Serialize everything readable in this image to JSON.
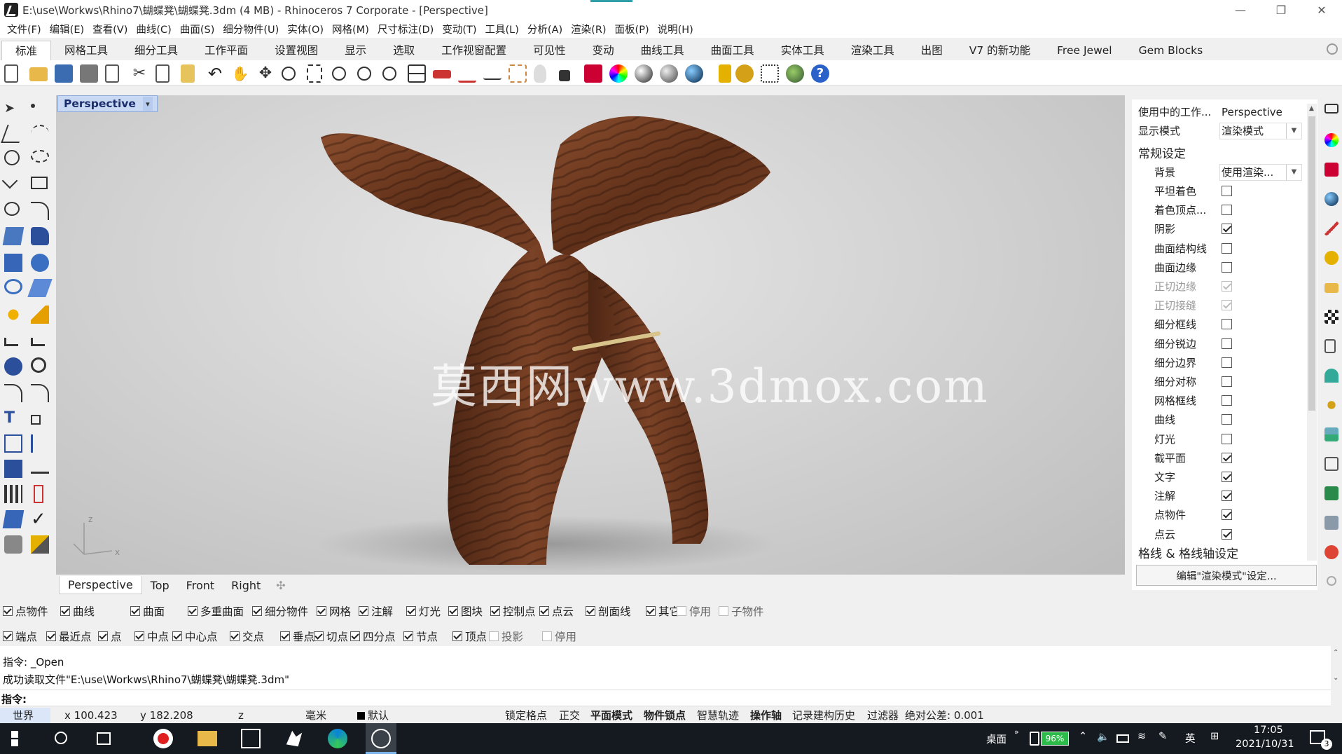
{
  "window": {
    "title": "E:\\use\\Workws\\Rhino7\\蝴蝶凳\\蝴蝶凳.3dm (4 MB) - Rhinoceros 7 Corporate - [Perspective]",
    "minimize": "—",
    "restore": "❐",
    "close": "✕"
  },
  "menu": [
    "文件(F)",
    "编辑(E)",
    "查看(V)",
    "曲线(C)",
    "曲面(S)",
    "细分物件(U)",
    "实体(O)",
    "网格(M)",
    "尺寸标注(D)",
    "变动(T)",
    "工具(L)",
    "分析(A)",
    "渲染(R)",
    "面板(P)",
    "说明(H)"
  ],
  "tabs": [
    "标准",
    "网格工具",
    "细分工具",
    "工作平面",
    "设置视图",
    "显示",
    "选取",
    "工作视窗配置",
    "可见性",
    "变动",
    "曲线工具",
    "曲面工具",
    "实体工具",
    "渲染工具",
    "出图",
    "V7 的新功能",
    "Free Jewel",
    "Gem Blocks"
  ],
  "viewport": {
    "label": "Perspective",
    "caret": "▾",
    "watermark": "莫西网www.3dmox.com",
    "axis_y": "z",
    "axis_x": "x"
  },
  "view_tabs": [
    "Perspective",
    "Top",
    "Front",
    "Right"
  ],
  "view_tabs_add": "✣",
  "panel": {
    "viewport_label": "使用中的工作...",
    "viewport_value": "Perspective",
    "display_mode_label": "显示模式",
    "display_mode_value": "渲染模式",
    "section_general": "常规设定",
    "background_label": "背景",
    "background_value": "使用渲染...",
    "rows": [
      {
        "label": "平坦着色",
        "checked": false,
        "disabled": false
      },
      {
        "label": "着色顶点...",
        "checked": false,
        "disabled": false
      },
      {
        "label": "阴影",
        "checked": true,
        "disabled": false
      },
      {
        "label": "曲面结构线",
        "checked": false,
        "disabled": false
      },
      {
        "label": "曲面边缘",
        "checked": false,
        "disabled": false
      },
      {
        "label": "正切边缘",
        "checked": true,
        "disabled": true
      },
      {
        "label": "正切接缝",
        "checked": true,
        "disabled": true
      },
      {
        "label": "细分框线",
        "checked": false,
        "disabled": false
      },
      {
        "label": "细分锐边",
        "checked": false,
        "disabled": false
      },
      {
        "label": "细分边界",
        "checked": false,
        "disabled": false
      },
      {
        "label": "细分对称",
        "checked": false,
        "disabled": false
      },
      {
        "label": "网格框线",
        "checked": false,
        "disabled": false
      },
      {
        "label": "曲线",
        "checked": false,
        "disabled": false
      },
      {
        "label": "灯光",
        "checked": false,
        "disabled": false
      },
      {
        "label": "截平面",
        "checked": true,
        "disabled": false
      },
      {
        "label": "文字",
        "checked": true,
        "disabled": false
      },
      {
        "label": "注解",
        "checked": true,
        "disabled": false
      },
      {
        "label": "点物件",
        "checked": true,
        "disabled": false
      },
      {
        "label": "点云",
        "checked": true,
        "disabled": false
      }
    ],
    "section_grid": "格线 & 格线轴设定",
    "edit_button": "编辑\"渲染模式\"设定..."
  },
  "filter_row": [
    {
      "label": "点物件",
      "checked": true,
      "disabled": false
    },
    {
      "label": "曲线",
      "checked": true,
      "disabled": false
    },
    {
      "label": "曲面",
      "checked": true,
      "disabled": false
    },
    {
      "label": "多重曲面",
      "checked": true,
      "disabled": false
    },
    {
      "label": "细分物件",
      "checked": true,
      "disabled": false
    },
    {
      "label": "网格",
      "checked": true,
      "disabled": false
    },
    {
      "label": "注解",
      "checked": true,
      "disabled": false
    },
    {
      "label": "灯光",
      "checked": true,
      "disabled": false
    },
    {
      "label": "图块",
      "checked": true,
      "disabled": false
    },
    {
      "label": "控制点",
      "checked": true,
      "disabled": false
    },
    {
      "label": "点云",
      "checked": true,
      "disabled": false
    },
    {
      "label": "剖面线",
      "checked": true,
      "disabled": false
    },
    {
      "label": "其它",
      "checked": true,
      "disabled": false
    },
    {
      "label": "停用",
      "checked": false,
      "disabled": true
    },
    {
      "label": "子物件",
      "checked": false,
      "disabled": true
    }
  ],
  "osnap_row": [
    {
      "label": "端点",
      "checked": true,
      "disabled": false
    },
    {
      "label": "最近点",
      "checked": true,
      "disabled": false
    },
    {
      "label": "点",
      "checked": true,
      "disabled": false
    },
    {
      "label": "中点",
      "checked": true,
      "disabled": false
    },
    {
      "label": "中心点",
      "checked": true,
      "disabled": false
    },
    {
      "label": "交点",
      "checked": true,
      "disabled": false
    },
    {
      "label": "垂点",
      "checked": true,
      "disabled": false
    },
    {
      "label": "切点",
      "checked": true,
      "disabled": false
    },
    {
      "label": "四分点",
      "checked": true,
      "disabled": false
    },
    {
      "label": "节点",
      "checked": true,
      "disabled": false
    },
    {
      "label": "顶点",
      "checked": true,
      "disabled": false
    },
    {
      "label": "投影",
      "checked": false,
      "disabled": true
    },
    {
      "label": "停用",
      "checked": false,
      "disabled": true
    }
  ],
  "command": {
    "history_1": "指令: _Open",
    "history_2": "成功读取文件\"E:\\use\\Workws\\Rhino7\\蝴蝶凳\\蝴蝶凳.3dm\"",
    "prompt": "指令:"
  },
  "status": {
    "cplane": "世界",
    "x": "x 100.423",
    "y": "y 182.208",
    "z": "z",
    "units": "毫米",
    "layer": "默认",
    "grid_snap": "锁定格点",
    "ortho": "正交",
    "planar": "平面模式",
    "osnap": "物件锁点",
    "smarttrack": "智慧轨迹",
    "gumball": "操作轴",
    "history": "记录建构历史",
    "filter": "过滤器",
    "tolerance": "绝对公差: 0.001"
  },
  "taskbar": {
    "desktop": "桌面",
    "battery": "96%",
    "ime": "英",
    "time": "17:05",
    "date": "2021/10/31",
    "notif_count": "3"
  },
  "colors": {
    "viewport_label_bg": "#c9d9f4",
    "wood": "#6e3a22",
    "taskbar": "#151a20"
  }
}
